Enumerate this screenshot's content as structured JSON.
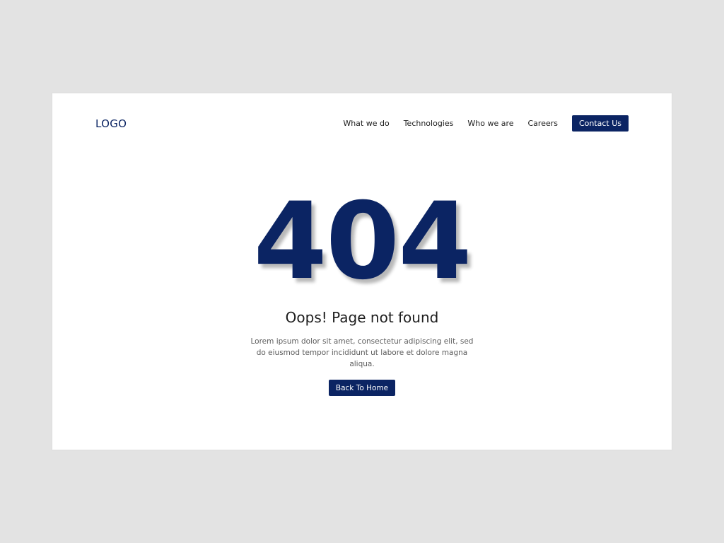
{
  "header": {
    "logo": "LOGO",
    "nav": [
      {
        "label": "What we do"
      },
      {
        "label": "Technologies"
      },
      {
        "label": "Who we are"
      },
      {
        "label": "Careers"
      }
    ],
    "cta_label": "Contact Us"
  },
  "main": {
    "code": "404",
    "title": "Oops! Page not found",
    "description": "Lorem ipsum dolor sit amet, consectetur adipiscing elit, sed do eiusmod tempor incididunt ut labore et dolore magna aliqua.",
    "button_label": "Back To Home"
  },
  "colors": {
    "brand": "#0b2463",
    "background": "#e3e3e3",
    "card": "#ffffff"
  }
}
